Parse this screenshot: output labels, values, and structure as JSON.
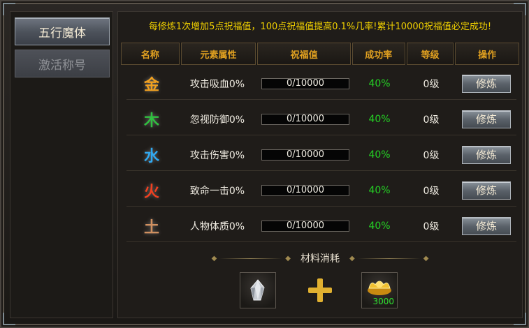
{
  "tabs": [
    {
      "label": "五行魔体",
      "active": true
    },
    {
      "label": "激活称号",
      "active": false
    }
  ],
  "notice": "每修炼1次增加5点祝福值，100点祝福值提高0.1%几率!累计10000祝福值必定成功!",
  "table": {
    "headers": [
      "名称",
      "元素属性",
      "祝福值",
      "成功率",
      "等级",
      "操作"
    ],
    "rows": [
      {
        "element": "金",
        "color": "#f0a020",
        "attribute": "攻击吸血0%",
        "blessing": "0/10000",
        "rate": "40%",
        "level": "0级",
        "action": "修炼"
      },
      {
        "element": "木",
        "color": "#30c040",
        "attribute": "忽视防御0%",
        "blessing": "0/10000",
        "rate": "40%",
        "level": "0级",
        "action": "修炼"
      },
      {
        "element": "水",
        "color": "#30a8f0",
        "attribute": "攻击伤害0%",
        "blessing": "0/10000",
        "rate": "40%",
        "level": "0级",
        "action": "修炼"
      },
      {
        "element": "火",
        "color": "#f04020",
        "attribute": "致命一击0%",
        "blessing": "0/10000",
        "rate": "40%",
        "level": "0级",
        "action": "修炼"
      },
      {
        "element": "土",
        "color": "#d09060",
        "attribute": "人物体质0%",
        "blessing": "0/10000",
        "rate": "40%",
        "level": "0级",
        "action": "修炼"
      }
    ]
  },
  "materials": {
    "title": "材料消耗",
    "items": [
      {
        "icon": "crystal-icon",
        "count": ""
      },
      {
        "icon": "gold-ingot-icon",
        "count": "3000"
      }
    ]
  }
}
